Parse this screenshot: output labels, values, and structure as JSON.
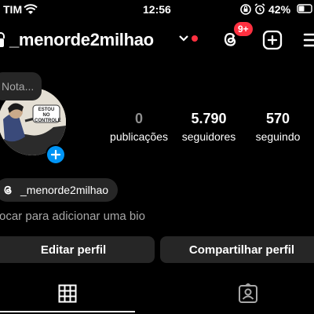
{
  "status_bar": {
    "carrier": "TIM",
    "time": "12:56",
    "battery": "42%"
  },
  "header": {
    "username": "_menorde2milhao",
    "threads_badge": "9+"
  },
  "note": {
    "placeholder": "Nota..."
  },
  "avatar": {
    "caption": "ESTOU NO CONTROLE"
  },
  "stats": [
    {
      "value": "0",
      "label": "publicações"
    },
    {
      "value": "5.790",
      "label": "seguidores"
    },
    {
      "value": "570",
      "label": "seguindo"
    }
  ],
  "threads_chip": {
    "label": "_menorde2milhao"
  },
  "bio_hint": "ocar para adicionar uma bio",
  "buttons": {
    "edit": "Editar perfil",
    "share": "Compartilhar perfil"
  },
  "colors": {
    "background": "#000000",
    "chip": "#262626",
    "accent_blue": "#0095f6",
    "badge_red": "#ff3040"
  },
  "icons": [
    "wifi-icon",
    "battery-icon",
    "threads-icon",
    "add-post-icon",
    "menu-icon",
    "grid-icon",
    "tagged-icon"
  ]
}
